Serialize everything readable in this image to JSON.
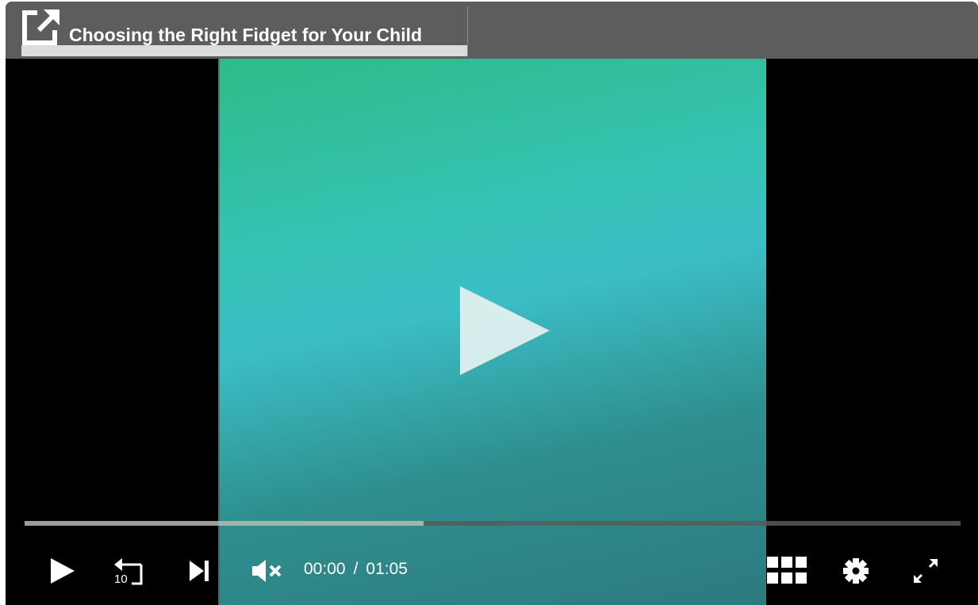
{
  "player": {
    "title": "Choosing the Right Fidget for Your Child",
    "colors": {
      "titlebar": "#5d5d5d",
      "accent_gradient_start": "#2dbb87",
      "accent_gradient_end": "#2c7a7f"
    }
  },
  "controls": {
    "icons": {
      "share": "share-external-icon",
      "big_play": "play-icon",
      "play": "play-icon",
      "rewind": "rewind-10-icon",
      "rewind_label": "10",
      "next": "skip-next-icon",
      "mute": "volume-muted-icon",
      "grid": "grid-icon",
      "settings": "gear-icon",
      "fullscreen": "fullscreen-icon"
    },
    "current_time": "00:00",
    "separator": "/",
    "duration": "01:05",
    "buffer_progress": 0.426
  }
}
